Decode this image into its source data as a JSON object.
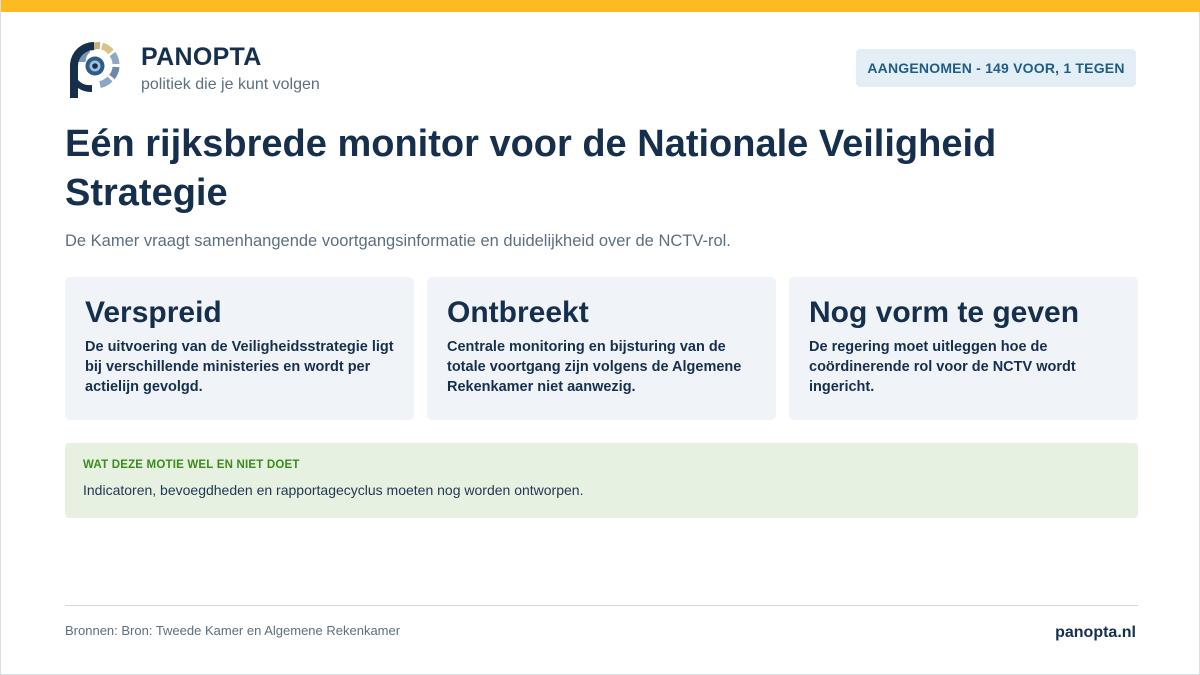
{
  "brand": {
    "name": "PANOPTA",
    "tagline": "politiek die je kunt volgen"
  },
  "status": {
    "label": "AANGENOMEN - 149 VOOR, 1 TEGEN"
  },
  "headline": {
    "title": "Eén rijksbrede monitor voor de Nationale Veiligheid Strategie",
    "subtitle": "De Kamer vraagt samenhangende voortgangsinformatie en duidelijkheid over de NCTV-rol."
  },
  "cards": [
    {
      "title": "Verspreid",
      "body": "De uitvoering van de Veiligheidsstrategie ligt bij verschillende ministeries en wordt per actielijn gevolgd."
    },
    {
      "title": "Ontbreekt",
      "body": "Centrale monitoring en bijsturing van de totale voortgang zijn volgens de Algemene Rekenkamer niet aanwezig."
    },
    {
      "title": "Nog vorm te geven",
      "body": "De regering moet uitleggen hoe de coördinerende rol voor de NCTV wordt ingericht."
    }
  ],
  "note": {
    "label": "WAT DEZE MOTIE WEL EN NIET DOET",
    "text": "Indicatoren, bevoegdheden en rapportagecyclus moeten nog worden ontworpen."
  },
  "footer": {
    "sources": "Bronnen: Bron: Tweede Kamer en Algemene Rekenkamer",
    "site": "panopta.nl"
  },
  "colors": {
    "accent_bar": "#fbbb21",
    "navy": "#152f4c",
    "badge_bg": "#e4eef6",
    "badge_text": "#1f5c86",
    "note_bg": "#e6f1e2",
    "note_label": "#3d8a1d",
    "card_bg": "#f0f4f8"
  },
  "icons": {
    "logo": "panopta-eye-logo"
  }
}
